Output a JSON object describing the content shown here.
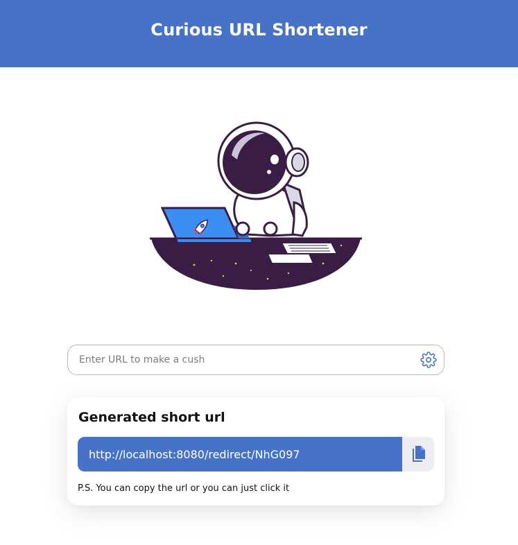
{
  "header": {
    "title": "Curious URL Shortener"
  },
  "hero": {
    "illustration": "astronaut-working-on-laptop"
  },
  "search": {
    "placeholder": "Enter URL to make a cush",
    "value": "",
    "settings_icon": "gear-icon"
  },
  "result": {
    "title": "Generated short url",
    "short_url": "http://localhost:8080/redirect/NhG097",
    "copy_icon": "copy-icon",
    "note": "P.S. You can copy the url or you can just click it"
  },
  "colors": {
    "primary": "#4673c8",
    "copy_bg": "#ececf1",
    "dark_space": "#3a1d44"
  }
}
